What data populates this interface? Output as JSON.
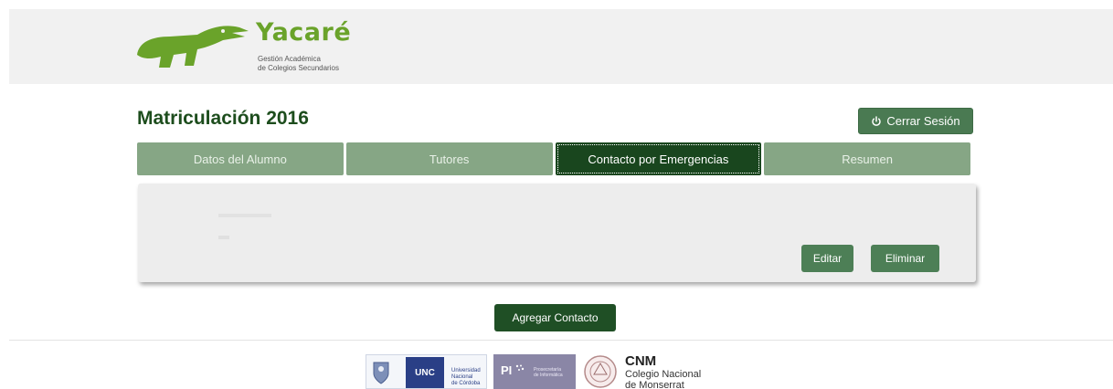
{
  "header": {
    "logo_title": "Yacaré",
    "logo_subtitle_line1": "Gestión Académica",
    "logo_subtitle_line2": "de Colegios Secundarios",
    "logo_color": "#6aa32a"
  },
  "page": {
    "title": "Matriculación 2016",
    "logout_label": "Cerrar Sesión",
    "logout_icon": "power-icon"
  },
  "tabs": [
    {
      "label": "Datos del Alumno",
      "active": false
    },
    {
      "label": "Tutores",
      "active": false
    },
    {
      "label": "Contacto por Emergencias",
      "active": true
    },
    {
      "label": "Resumen",
      "active": false
    }
  ],
  "contact_card": {
    "edit_label": "Editar",
    "delete_label": "Eliminar"
  },
  "add_contact_label": "Agregar Contacto",
  "footer": {
    "unc_badge": "UNC",
    "unc_text_line1": "Universidad",
    "unc_text_line2": "Nacional",
    "unc_text_line3": "de Córdoba",
    "pi_mark": "PI",
    "pi_text_line1": "Prosecretaría",
    "pi_text_line2": "de Informática",
    "cnm_abbr": "CNM",
    "cnm_line1": "Colegio Nacional",
    "cnm_line2": "de Monserrat"
  },
  "colors": {
    "tab_inactive": "#86a685",
    "tab_active": "#19461e",
    "button_green": "#4d7f56",
    "button_dark": "#1f4f25",
    "title_color": "#1d4d1d"
  }
}
